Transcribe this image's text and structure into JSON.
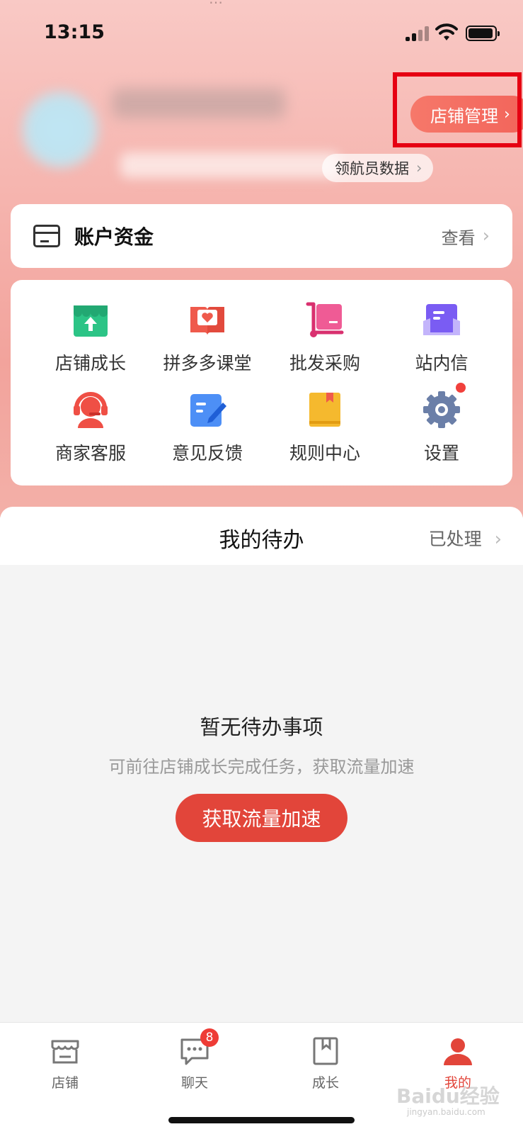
{
  "status": {
    "time": "13:15"
  },
  "header": {
    "top_partial_text": "…",
    "shop_manage_label": "店铺管理",
    "chevron": "›",
    "nav_data_label": "领航员数据"
  },
  "account": {
    "title": "账户资金",
    "view_label": "查看"
  },
  "grid": {
    "items": [
      {
        "label": "店铺成长",
        "icon": "store-growth-icon",
        "color": "#2cc486"
      },
      {
        "label": "拼多多课堂",
        "icon": "course-book-icon",
        "color": "#ef5a4c"
      },
      {
        "label": "批发采购",
        "icon": "wholesale-cart-icon",
        "color": "#e73d7f"
      },
      {
        "label": "站内信",
        "icon": "message-inbox-icon",
        "color": "#7a5cf3"
      },
      {
        "label": "商家客服",
        "icon": "customer-service-icon",
        "color": "#ef4f45"
      },
      {
        "label": "意见反馈",
        "icon": "feedback-edit-icon",
        "color": "#3b82f6"
      },
      {
        "label": "规则中心",
        "icon": "rule-book-icon",
        "color": "#f5b92e"
      },
      {
        "label": "设置",
        "icon": "gear-icon",
        "color": "#6b7fa8"
      }
    ]
  },
  "todo": {
    "title": "我的待办",
    "done_label": "已处理",
    "empty_title": "暂无待办事项",
    "empty_sub": "可前往店铺成长完成任务，获取流量加速",
    "cta_label": "获取流量加速"
  },
  "tabbar": {
    "items": [
      {
        "label": "店铺",
        "icon": "store-icon"
      },
      {
        "label": "聊天",
        "icon": "chat-icon",
        "badge": "8"
      },
      {
        "label": "成长",
        "icon": "bookmark-icon"
      },
      {
        "label": "我的",
        "icon": "user-icon",
        "active": true
      }
    ]
  },
  "watermark": {
    "text": "Baidu经验",
    "sub": "jingyan.baidu.com"
  },
  "colors": {
    "accent": "#e2453a",
    "highlight": "#e60012"
  }
}
